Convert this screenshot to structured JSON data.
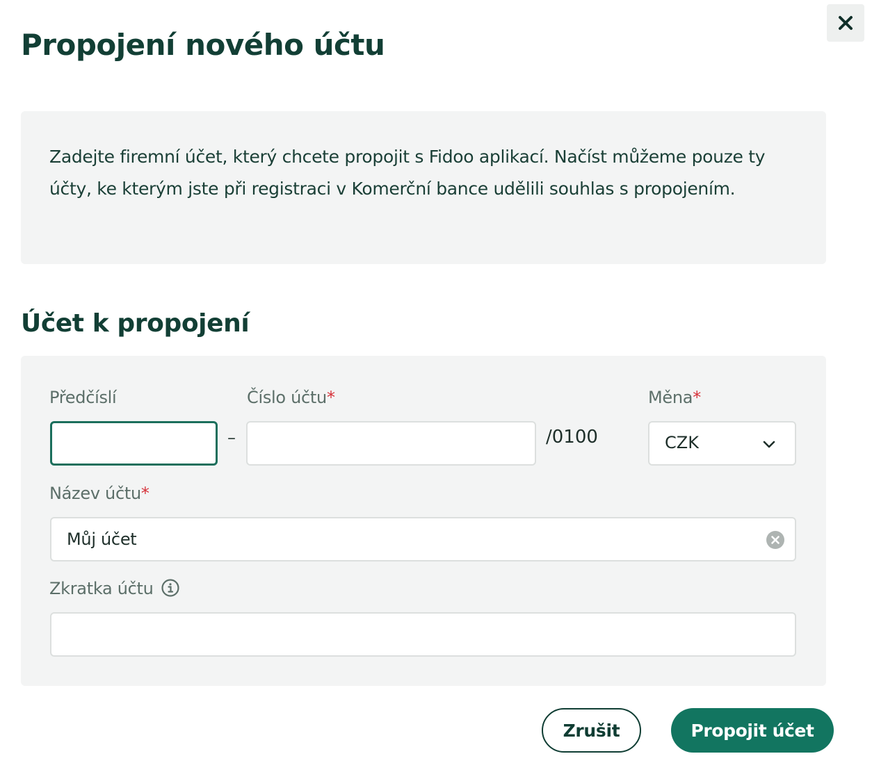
{
  "dialog": {
    "title": "Propojení nového účtu",
    "close_icon": "close-icon"
  },
  "info": {
    "text": "Zadejte firemní účet, který chcete propojit s Fidoo aplikací. Načíst můžeme pouze ty účty, ke kterým jste při registraci v Komerční bance udělili souhlas s propojením."
  },
  "section": {
    "title": "Účet k propojení"
  },
  "form": {
    "prefix": {
      "label": "Předčíslí",
      "value": ""
    },
    "account_number": {
      "label": "Číslo účtu",
      "required_mark": "*",
      "value": ""
    },
    "separator": "–",
    "bank_code": "/0100",
    "currency": {
      "label": "Měna",
      "required_mark": "*",
      "selected": "CZK",
      "icon": "chevron-down-icon"
    },
    "account_name": {
      "label": "Název účtu",
      "required_mark": "*",
      "value": "Můj účet",
      "clear_icon": "clear-icon"
    },
    "account_abbreviation": {
      "label": "Zkratka účtu",
      "info_icon": "info-icon",
      "value": ""
    }
  },
  "actions": {
    "cancel_label": "Zrušit",
    "submit_label": "Propojit účet"
  },
  "colors": {
    "primary": "#127560",
    "heading": "#123f35",
    "panel_bg": "#f3f4f4",
    "required": "#d6323a",
    "focus_border": "#1b6f5c"
  }
}
